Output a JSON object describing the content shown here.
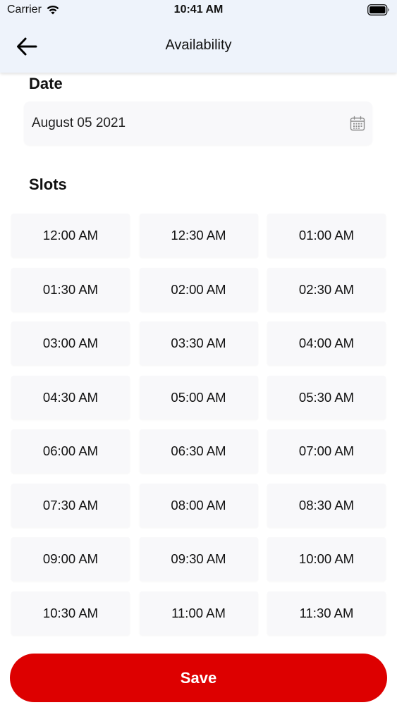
{
  "status_bar": {
    "carrier": "Carrier",
    "time": "10:41 AM",
    "wifi_icon": "wifi-icon",
    "battery_icon": "battery-icon"
  },
  "header": {
    "title": "Availability",
    "back_icon": "arrow-left-icon",
    "background": "#eef3fb"
  },
  "date": {
    "label": "Date",
    "value": "August 05 2021",
    "icon": "calendar-icon"
  },
  "slots": {
    "label": "Slots",
    "items": [
      "12:00 AM",
      "12:30 AM",
      "01:00 AM",
      "01:30 AM",
      "02:00 AM",
      "02:30 AM",
      "03:00 AM",
      "03:30 AM",
      "04:00 AM",
      "04:30 AM",
      "05:00 AM",
      "05:30 AM",
      "06:00 AM",
      "06:30 AM",
      "07:00 AM",
      "07:30 AM",
      "08:00 AM",
      "08:30 AM",
      "09:00 AM",
      "09:30 AM",
      "10:00 AM",
      "10:30 AM",
      "11:00 AM",
      "11:30 AM"
    ]
  },
  "actions": {
    "save_label": "Save",
    "accent": "#dd0000"
  }
}
